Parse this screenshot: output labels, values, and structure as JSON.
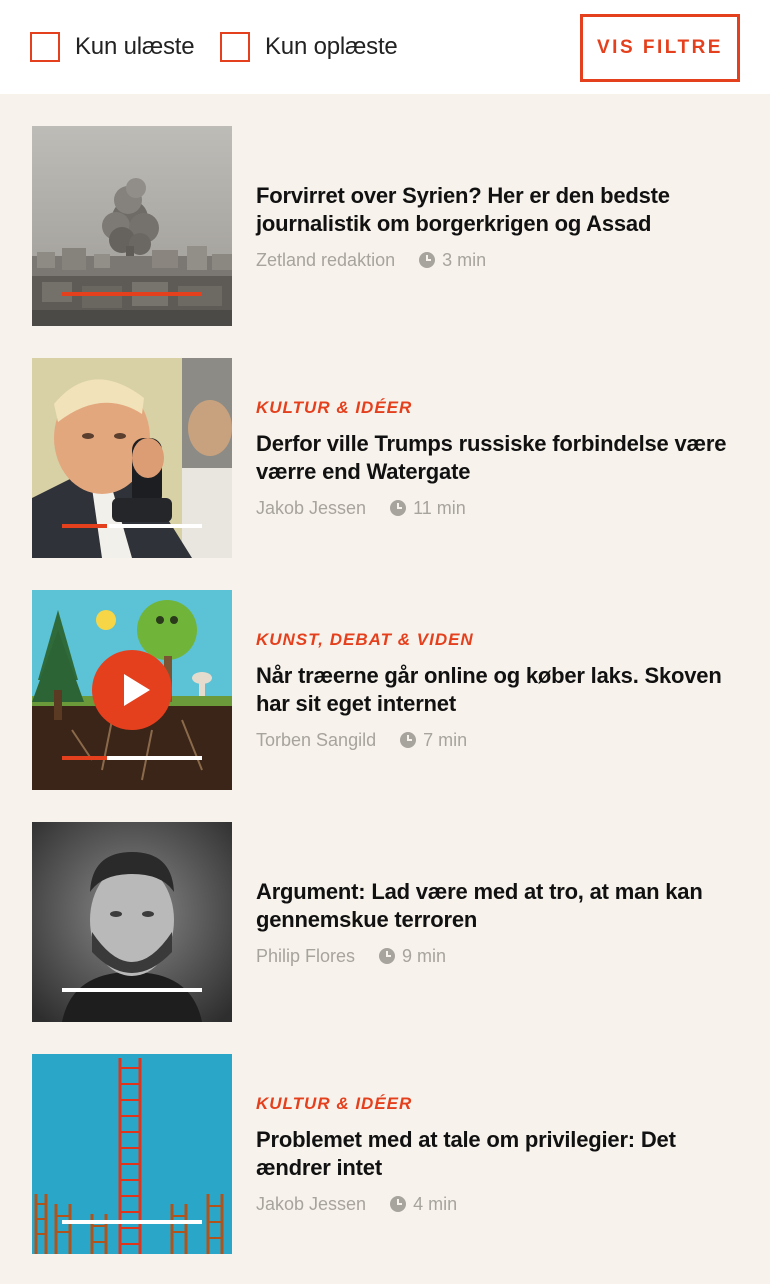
{
  "filters": {
    "unread_label": "Kun ulæste",
    "read_aloud_label": "Kun oplæste",
    "show_filters_label": "VIS FILTRE"
  },
  "colors": {
    "accent": "#e5401d",
    "background": "#f7f3ec",
    "meta": "#a7a39d"
  },
  "articles": [
    {
      "category": "",
      "title": "Forvirret over Syrien? Her er den bedste journalistik om borgerkrigen og Assad",
      "author": "Zetland redaktion",
      "duration": "3 min",
      "progress": 1.0,
      "has_play": false
    },
    {
      "category": "KULTUR & IDÉER",
      "title": "Derfor ville Trumps russiske forbindelse være værre end Watergate",
      "author": "Jakob Jessen",
      "duration": "11 min",
      "progress": 0.32,
      "has_play": false
    },
    {
      "category": "KUNST, DEBAT & VIDEN",
      "title": "Når træerne går online og køber laks. Skoven har sit eget internet",
      "author": "Torben Sangild",
      "duration": "7 min",
      "progress": 0.32,
      "has_play": true
    },
    {
      "category": "",
      "title": "Argument: Lad være med at tro, at man kan gennemskue terroren",
      "author": "Philip Flores",
      "duration": "9 min",
      "progress": 0,
      "has_play": false
    },
    {
      "category": "KULTUR & IDÉER",
      "title": "Problemet med at tale om privilegier: Det ændrer intet",
      "author": "Jakob Jessen",
      "duration": "4 min",
      "progress": 0,
      "has_play": false
    }
  ]
}
